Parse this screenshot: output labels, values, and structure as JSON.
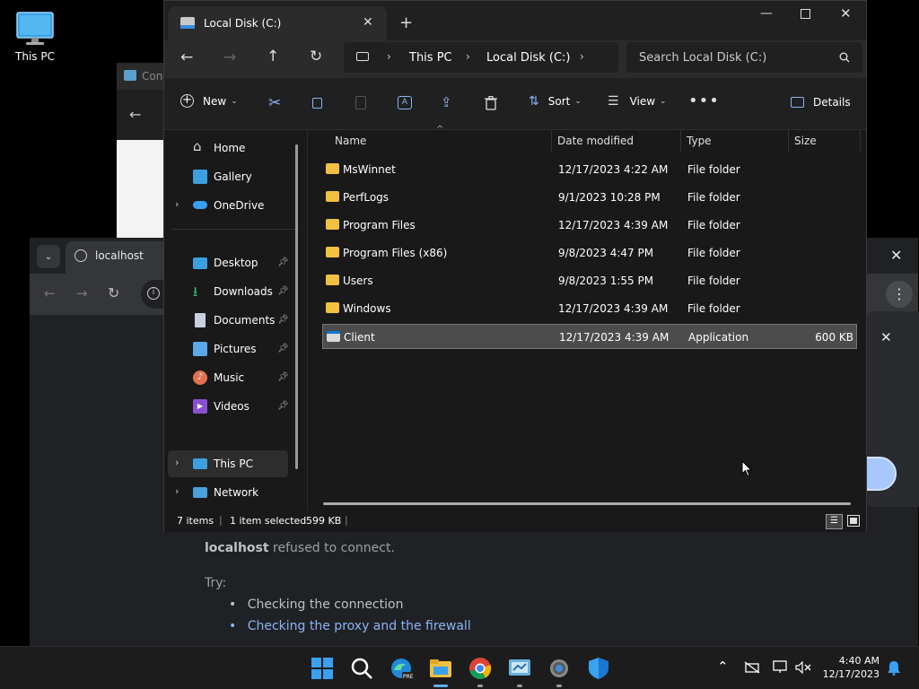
{
  "desktop": {
    "icon_label": "This PC"
  },
  "chrome": {
    "tab_title": "localhost",
    "error_host": "localhost",
    "error_msg": "refused to connect.",
    "try_label": "Try:",
    "suggestions": [
      "Checking the connection",
      "Checking the proxy and the firewall"
    ]
  },
  "cpanel": {
    "title_fragment": "Con"
  },
  "explorer": {
    "tab_title": "Local Disk (C:)",
    "breadcrumb": [
      "This PC",
      "Local Disk (C:)"
    ],
    "search_placeholder": "Search Local Disk (C:)",
    "commands": {
      "new": "New",
      "sort": "Sort",
      "view": "View",
      "details": "Details"
    },
    "nav": {
      "home": "Home",
      "gallery": "Gallery",
      "onedrive": "OneDrive",
      "desktop": "Desktop",
      "downloads": "Downloads",
      "documents": "Documents",
      "pictures": "Pictures",
      "music": "Music",
      "videos": "Videos",
      "thispc": "This PC",
      "network": "Network"
    },
    "columns": {
      "name": "Name",
      "date": "Date modified",
      "type": "Type",
      "size": "Size"
    },
    "files": [
      {
        "name": "MsWinnet",
        "date": "12/17/2023 4:22 AM",
        "type": "File folder",
        "size": ""
      },
      {
        "name": "PerfLogs",
        "date": "9/1/2023 10:28 PM",
        "type": "File folder",
        "size": ""
      },
      {
        "name": "Program Files",
        "date": "12/17/2023 4:39 AM",
        "type": "File folder",
        "size": ""
      },
      {
        "name": "Program Files (x86)",
        "date": "9/8/2023 4:47 PM",
        "type": "File folder",
        "size": ""
      },
      {
        "name": "Users",
        "date": "9/8/2023 1:55 PM",
        "type": "File folder",
        "size": ""
      },
      {
        "name": "Windows",
        "date": "12/17/2023 4:39 AM",
        "type": "File folder",
        "size": ""
      },
      {
        "name": "Client",
        "date": "12/17/2023 4:39 AM",
        "type": "Application",
        "size": "600 KB"
      }
    ],
    "status": {
      "count": "7 items",
      "selected": "1 item selected",
      "size": "599 KB"
    }
  },
  "taskbar": {
    "time": "4:40 AM",
    "date": "12/17/2023"
  },
  "colors": {
    "accent": "#0078d4",
    "folder": "#f0c040",
    "selection": "#4c4c4c"
  }
}
